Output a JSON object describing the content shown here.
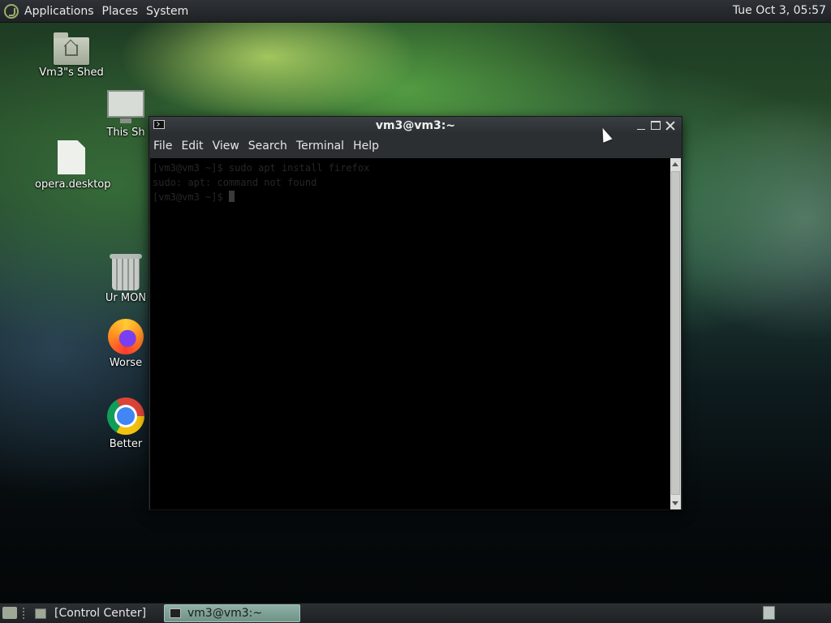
{
  "top_panel": {
    "menus": [
      "Applications",
      "Places",
      "System"
    ],
    "clock": "Tue Oct  3, 05:57"
  },
  "desktop_icons": [
    {
      "label": "Vm3\"s Shed",
      "icon": "home-folder-icon"
    },
    {
      "label": "This Sh",
      "icon": "computer-icon"
    },
    {
      "label": "opera.desktop",
      "icon": "document-icon"
    },
    {
      "label": "Ur MON",
      "icon": "trash-icon"
    },
    {
      "label": "Worse",
      "icon": "firefox-icon"
    },
    {
      "label": "Better",
      "icon": "chrome-icon"
    }
  ],
  "terminal": {
    "title": "vm3@vm3:~",
    "menu": [
      "File",
      "Edit",
      "View",
      "Search",
      "Terminal",
      "Help"
    ],
    "lines": [
      "[vm3@vm3 ~]$ sudo apt install firefox",
      "sudo: apt: command not found",
      "[vm3@vm3 ~]$ "
    ]
  },
  "bottom_panel": {
    "tasks": [
      "[Control Center]",
      "vm3@vm3:~"
    ]
  }
}
